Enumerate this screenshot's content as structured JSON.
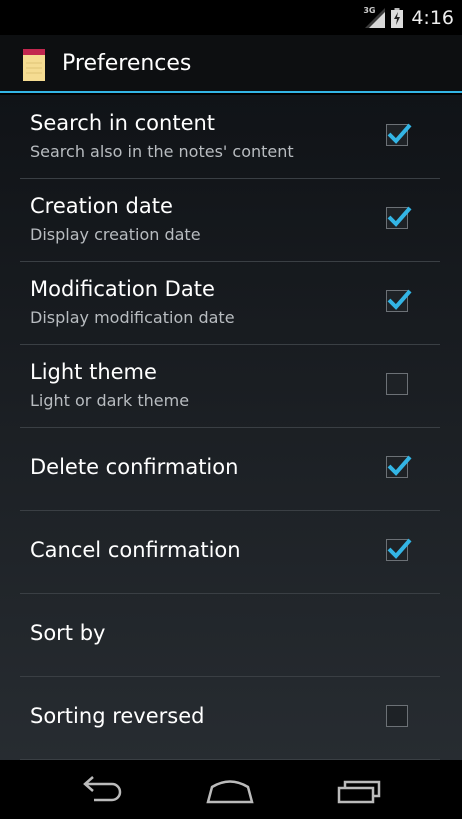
{
  "status_bar": {
    "network": "3G",
    "time": "4:16"
  },
  "action_bar": {
    "title": "Preferences",
    "app_icon": "notepad-icon"
  },
  "colors": {
    "accent": "#33b5e5",
    "divider": "#3a3f44",
    "summary_text": "#b8bcc0"
  },
  "preferences": [
    {
      "title": "Search in content",
      "summary": "Search also in the notes' content",
      "has_checkbox": true,
      "checked": true
    },
    {
      "title": "Creation date",
      "summary": "Display creation date",
      "has_checkbox": true,
      "checked": true
    },
    {
      "title": "Modification Date",
      "summary": "Display modification date",
      "has_checkbox": true,
      "checked": true
    },
    {
      "title": "Light theme",
      "summary": "Light or dark theme",
      "has_checkbox": true,
      "checked": false
    },
    {
      "title": "Delete confirmation",
      "summary": "",
      "has_checkbox": true,
      "checked": true
    },
    {
      "title": "Cancel confirmation",
      "summary": "",
      "has_checkbox": true,
      "checked": true
    },
    {
      "title": "Sort by",
      "summary": "",
      "has_checkbox": false,
      "checked": false
    },
    {
      "title": "Sorting reversed",
      "summary": "",
      "has_checkbox": true,
      "checked": false
    }
  ],
  "nav_bar": {
    "icons": [
      "back-icon",
      "home-icon",
      "recent-apps-icon"
    ]
  }
}
